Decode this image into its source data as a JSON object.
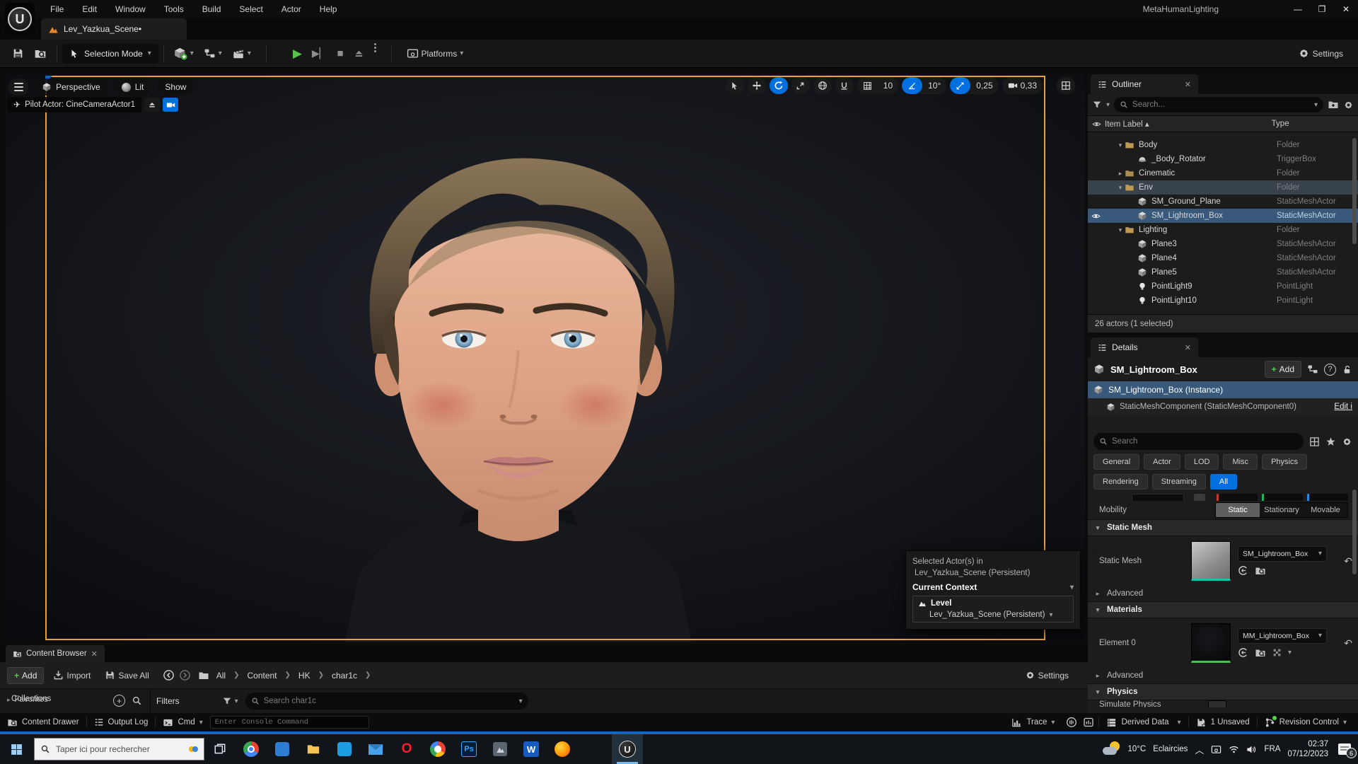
{
  "window": {
    "title": "MetaHumanLighting",
    "menus": [
      "File",
      "Edit",
      "Window",
      "Tools",
      "Build",
      "Select",
      "Actor",
      "Help"
    ],
    "controls": {
      "minimize": "—",
      "maximize": "❐",
      "close": "✕"
    }
  },
  "scene_tab": {
    "label": "Lev_Yazkua_Scene•"
  },
  "toolbar": {
    "selection_mode": "Selection Mode",
    "platforms": "Platforms",
    "settings": "Settings"
  },
  "viewport": {
    "perspective": "Perspective",
    "lit": "Lit",
    "show": "Show",
    "pilot": "Pilot Actor: CineCameraActor1",
    "grid_snap": "10",
    "angle_snap": "10°",
    "scale_snap": "0,25",
    "camera_speed": "0,33"
  },
  "outliner": {
    "title": "Outliner",
    "search_placeholder": "Search...",
    "columns": {
      "item_label": "Item Label ▴",
      "type": "Type"
    },
    "rows": [
      {
        "label": "Body",
        "type": "Folder"
      },
      {
        "label": "_Body_Rotator",
        "type": "TriggerBox"
      },
      {
        "label": "Cinematic",
        "type": "Folder"
      },
      {
        "label": "Env",
        "type": "Folder"
      },
      {
        "label": "SM_Ground_Plane",
        "type": "StaticMeshActor"
      },
      {
        "label": "SM_Lightroom_Box",
        "type": "StaticMeshActor"
      },
      {
        "label": "Lighting",
        "type": "Folder"
      },
      {
        "label": "Plane3",
        "type": "StaticMeshActor"
      },
      {
        "label": "Plane4",
        "type": "StaticMeshActor"
      },
      {
        "label": "Plane5",
        "type": "StaticMeshActor"
      },
      {
        "label": "PointLight9",
        "type": "PointLight"
      },
      {
        "label": "PointLight10",
        "type": "PointLight"
      }
    ],
    "footer": "26 actors (1 selected)"
  },
  "details": {
    "title": "Details",
    "header_name": "SM_Lightroom_Box",
    "add_label": "Add",
    "instance_row": "SM_Lightroom_Box (Instance)",
    "component_row": "StaticMeshComponent (StaticMeshComponent0)",
    "edit_link": "Edit i",
    "search_placeholder": "Search",
    "category_tabs": [
      "General",
      "Actor",
      "LOD",
      "Misc",
      "Physics",
      "Rendering",
      "Streaming",
      "All"
    ],
    "mobility": {
      "label": "Mobility",
      "options": [
        "Static",
        "Stationary",
        "Movable"
      ],
      "selected": "Static"
    },
    "static_mesh_section": "Static Mesh",
    "static_mesh_label": "Static Mesh",
    "static_mesh_value": "SM_Lightroom_Box",
    "advanced_label": "Advanced",
    "materials_section": "Materials",
    "element_label": "Element 0",
    "material_value": "MM_Lightroom_Box",
    "physics_section": "Physics",
    "simulate_label": "Simulate Physics"
  },
  "context_popup": {
    "line1": "Selected Actor(s) in",
    "line2": "Lev_Yazkua_Scene (Persistent)",
    "header": "Current Context",
    "level_label": "Level",
    "level_value": "Lev_Yazkua_Scene (Persistent)"
  },
  "content_browser": {
    "tab": "Content Browser",
    "add": "Add",
    "import": "Import",
    "save_all": "Save All",
    "breadcrumbs": [
      "All",
      "Content",
      "HK",
      "char1c"
    ],
    "settings": "Settings",
    "favorites": "Favorites",
    "collections": "Collections",
    "filters": "Filters",
    "search_placeholder": "Search char1c"
  },
  "status_bar": {
    "content_drawer": "Content Drawer",
    "output_log": "Output Log",
    "cmd": "Cmd",
    "console_placeholder": "Enter Console Command",
    "trace": "Trace",
    "derived_data": "Derived Data",
    "unsaved": "1 Unsaved",
    "revision_control": "Revision Control"
  },
  "taskbar": {
    "search_placeholder": "Taper ici pour rechercher",
    "weather_temp": "10°C",
    "weather_desc": "Eclaircies",
    "language": "FRA",
    "time": "02:37",
    "date": "07/12/2023",
    "notification_count": "6"
  },
  "colors": {
    "accent_blue": "#0070e0",
    "selection_blue": "#39597a",
    "viewport_border_orange": "#e9a23b",
    "play_green": "#58c24a",
    "add_green": "#49d649",
    "mesh_underline_cyan": "#17c3ac",
    "material_underline_green": "#3fc94a"
  }
}
